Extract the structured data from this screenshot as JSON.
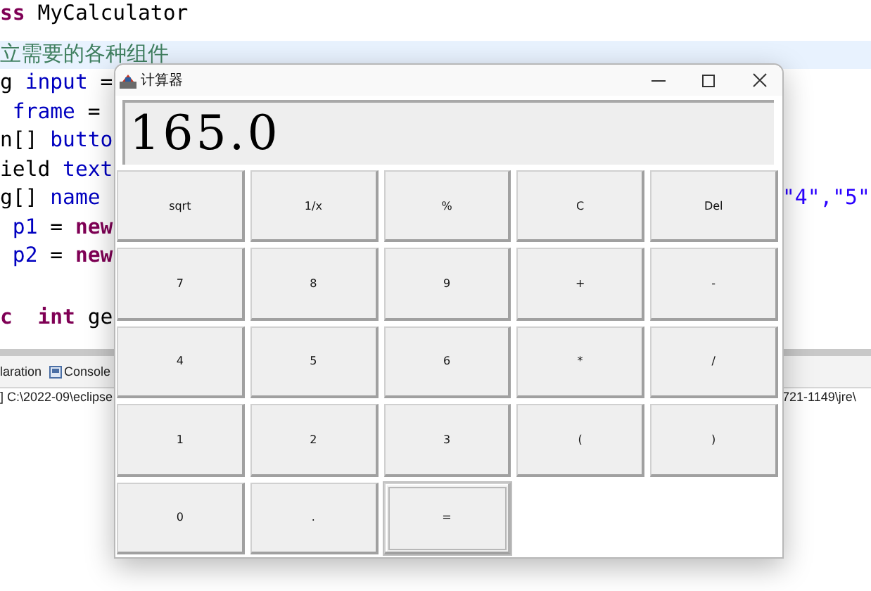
{
  "editor": {
    "blocks": [
      [
        {
          "current": false,
          "left": [
            {
              "text": "ss",
              "kind": "keyword"
            },
            {
              "text": " MyCalculator",
              "kind": "plain"
            }
          ]
        }
      ],
      [
        {
          "current": true,
          "left": [
            {
              "text": "立需要的各种组件",
              "kind": "comment"
            }
          ]
        },
        {
          "current": false,
          "left": [
            {
              "text": "g ",
              "kind": "plain"
            },
            {
              "text": "input",
              "kind": "field"
            },
            {
              "text": " =",
              "kind": "plain"
            }
          ]
        },
        {
          "current": false,
          "left": [
            {
              "text": " frame",
              "kind": "field"
            },
            {
              "text": " =",
              "kind": "plain"
            }
          ]
        },
        {
          "current": false,
          "left": [
            {
              "text": "n[] ",
              "kind": "plain"
            },
            {
              "text": "butto",
              "kind": "field"
            }
          ]
        },
        {
          "current": false,
          "left": [
            {
              "text": "ield ",
              "kind": "plain"
            },
            {
              "text": "text",
              "kind": "field"
            }
          ]
        },
        {
          "current": false,
          "left": [
            {
              "text": "g[] ",
              "kind": "plain"
            },
            {
              "text": "name",
              "kind": "field"
            }
          ],
          "right": [
            {
              "text": "\"4\",\"5\"",
              "kind": "string"
            }
          ]
        },
        {
          "current": false,
          "left": [
            {
              "text": " p1",
              "kind": "field"
            },
            {
              "text": " = ",
              "kind": "plain"
            },
            {
              "text": "new",
              "kind": "keyword"
            }
          ]
        },
        {
          "current": false,
          "left": [
            {
              "text": " p2",
              "kind": "field"
            },
            {
              "text": " = ",
              "kind": "plain"
            },
            {
              "text": "new",
              "kind": "keyword"
            }
          ]
        }
      ],
      [
        {
          "current": false,
          "left": [
            {
              "text": "c",
              "kind": "keyword"
            },
            {
              "text": "  int",
              "kind": "keyword"
            },
            {
              "text": " ge",
              "kind": "plain"
            }
          ]
        }
      ]
    ]
  },
  "console": {
    "tabs": [
      {
        "label": "laration",
        "kind": "text"
      },
      {
        "label": "Console",
        "kind": "icon"
      }
    ],
    "path_left": "] C:\\2022-09\\eclipse",
    "path_right": "721-1149\\jre\\"
  },
  "window": {
    "title": "计算器",
    "display": {
      "value": "165.0"
    },
    "buttons": [
      {
        "label": "sqrt",
        "focused": false
      },
      {
        "label": "1/x",
        "focused": false
      },
      {
        "label": "%",
        "focused": false
      },
      {
        "label": "C",
        "focused": false
      },
      {
        "label": "Del",
        "focused": false
      },
      {
        "label": "7",
        "focused": false
      },
      {
        "label": "8",
        "focused": false
      },
      {
        "label": "9",
        "focused": false
      },
      {
        "label": "+",
        "focused": false
      },
      {
        "label": "-",
        "focused": false
      },
      {
        "label": "4",
        "focused": false
      },
      {
        "label": "5",
        "focused": false
      },
      {
        "label": "6",
        "focused": false
      },
      {
        "label": "*",
        "focused": false
      },
      {
        "label": "/",
        "focused": false
      },
      {
        "label": "1",
        "focused": false
      },
      {
        "label": "2",
        "focused": false
      },
      {
        "label": "3",
        "focused": false
      },
      {
        "label": "(",
        "focused": false
      },
      {
        "label": ")",
        "focused": false
      },
      {
        "label": "0",
        "focused": false
      },
      {
        "label": ".",
        "focused": false
      },
      {
        "label": "=",
        "focused": true
      }
    ]
  }
}
